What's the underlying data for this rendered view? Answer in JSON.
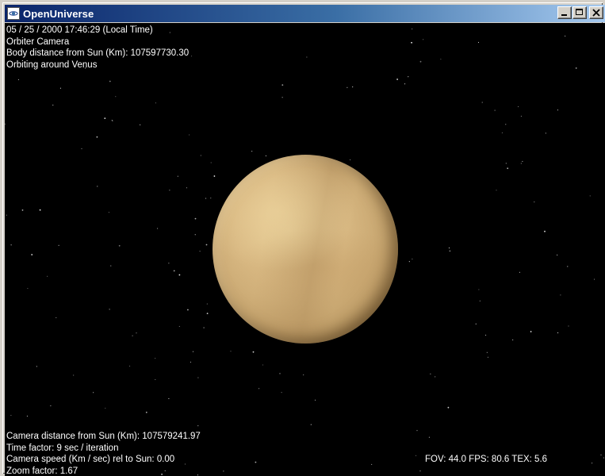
{
  "window": {
    "title": "OpenUniverse"
  },
  "hud": {
    "top_left": [
      "05 / 25 / 2000  17:46:29 (Local Time)",
      "Orbiter Camera",
      "Body distance from Sun (Km): 107597730.30",
      "Orbiting around Venus"
    ],
    "bottom_left": [
      "Camera distance from Sun (Km): 107579241.97",
      "Time factor: 9 sec / iteration",
      "Camera speed (Km / sec) rel to Sun: 0.00",
      "Zoom factor: 1.67"
    ],
    "bottom_right": "FOV: 44.0  FPS: 80.6 TEX: 5.6"
  },
  "icons": {
    "app": "openuniverse-app-icon",
    "minimize": "minimize-icon",
    "maximize": "maximize-icon",
    "close": "close-icon"
  },
  "colors": {
    "titlebar_start": "#0a246a",
    "titlebar_end": "#a6caf0",
    "space": "#000000",
    "hud_text": "#ffffff",
    "planet": "#d8b882"
  }
}
